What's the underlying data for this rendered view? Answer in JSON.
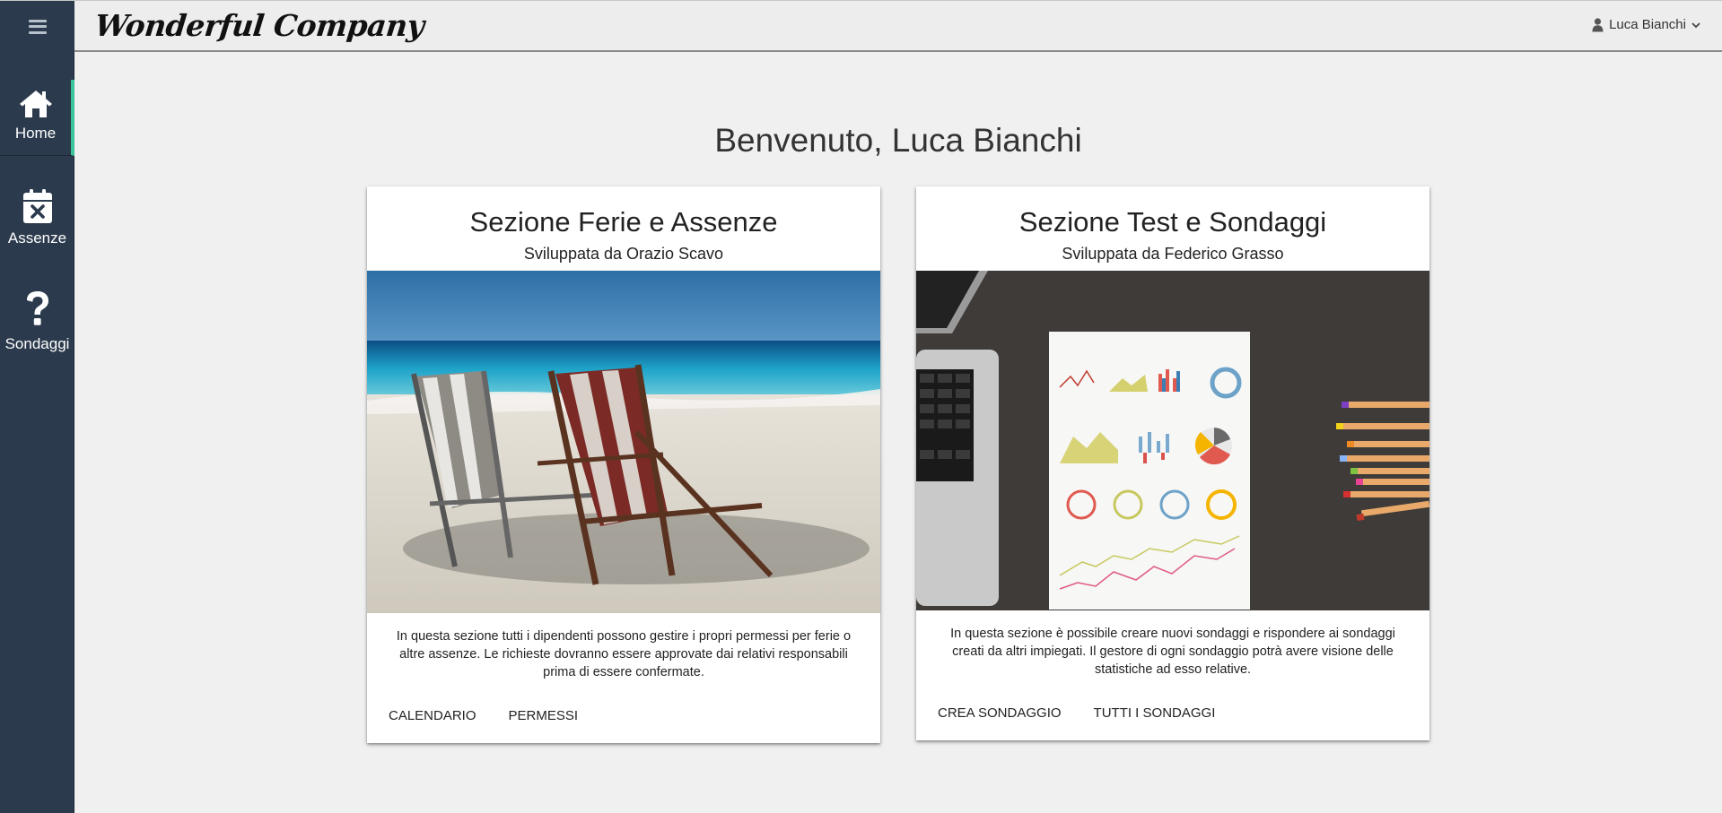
{
  "header": {
    "brand": "Wonderful Company",
    "user_name": "Luca Bianchi"
  },
  "sidebar": {
    "items": [
      {
        "label": "Home",
        "icon": "home-icon"
      },
      {
        "label": "Assenze",
        "icon": "calendar-x-icon"
      },
      {
        "label": "Sondaggi",
        "icon": "question-icon"
      }
    ]
  },
  "main": {
    "welcome": "Benvenuto, Luca Bianchi",
    "cards": [
      {
        "title": "Sezione Ferie e Assenze",
        "subtitle": "Sviluppata da Orazio Scavo",
        "description": "In questa sezione tutti i dipendenti possono gestire i propri permessi per ferie o altre assenze. Le richieste dovranno essere approvate dai relativi responsabili prima di essere confermate.",
        "actions": [
          "CALENDARIO",
          "PERMESSI"
        ]
      },
      {
        "title": "Sezione Test e Sondaggi",
        "subtitle": "Sviluppata da Federico Grasso",
        "description": "In questa sezione è possibile creare nuovi sondaggi e rispondere ai sondaggi creati da altri impiegati. Il gestore di ogni sondaggio potrà avere visione delle statistiche ad esso relative.",
        "actions": [
          "CREA SONDAGGIO",
          "TUTTI I SONDAGGI"
        ]
      }
    ]
  },
  "colors": {
    "sidebar_bg": "#2b3a4d",
    "active_accent": "#3cc49a",
    "page_bg": "#f0f0f0"
  }
}
